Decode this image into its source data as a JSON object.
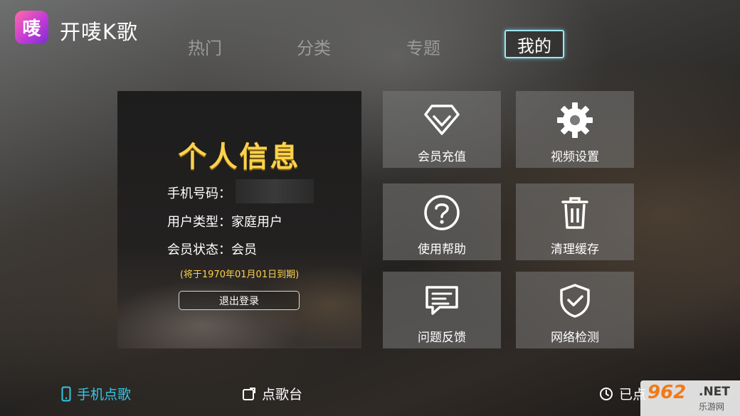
{
  "app": {
    "logo_glyph": "唛",
    "name": "开唛K歌"
  },
  "tabs": [
    {
      "label": "热门",
      "active": false
    },
    {
      "label": "分类",
      "active": false
    },
    {
      "label": "专题",
      "active": false
    },
    {
      "label": "我的",
      "active": true
    }
  ],
  "profile": {
    "title": "个人信息",
    "phone_label": "手机号码：",
    "user_type_label": "用户类型：",
    "user_type_value": "家庭用户",
    "member_status_label": "会员状态：",
    "member_status_value": "会员",
    "expiry_text": "(将于1970年01月01日到期)",
    "logout_label": "退出登录"
  },
  "tiles": [
    {
      "label": "会员充值",
      "icon": "diamond-icon"
    },
    {
      "label": "视频设置",
      "icon": "gear-icon"
    },
    {
      "label": "使用帮助",
      "icon": "question-icon"
    },
    {
      "label": "清理缓存",
      "icon": "trash-icon"
    },
    {
      "label": "问题反馈",
      "icon": "message-icon"
    },
    {
      "label": "网络检测",
      "icon": "shield-check-icon"
    }
  ],
  "bottom_bar": {
    "phone_song": "手机点歌",
    "song_station": "点歌台",
    "ordered": "已点"
  },
  "watermark": {
    "num": "962",
    "net": ".NET",
    "cn": "乐游网"
  },
  "colors": {
    "accent": "#36c6e6",
    "gold": "#ffd24a",
    "tab_inactive": "#9a9a9a"
  }
}
